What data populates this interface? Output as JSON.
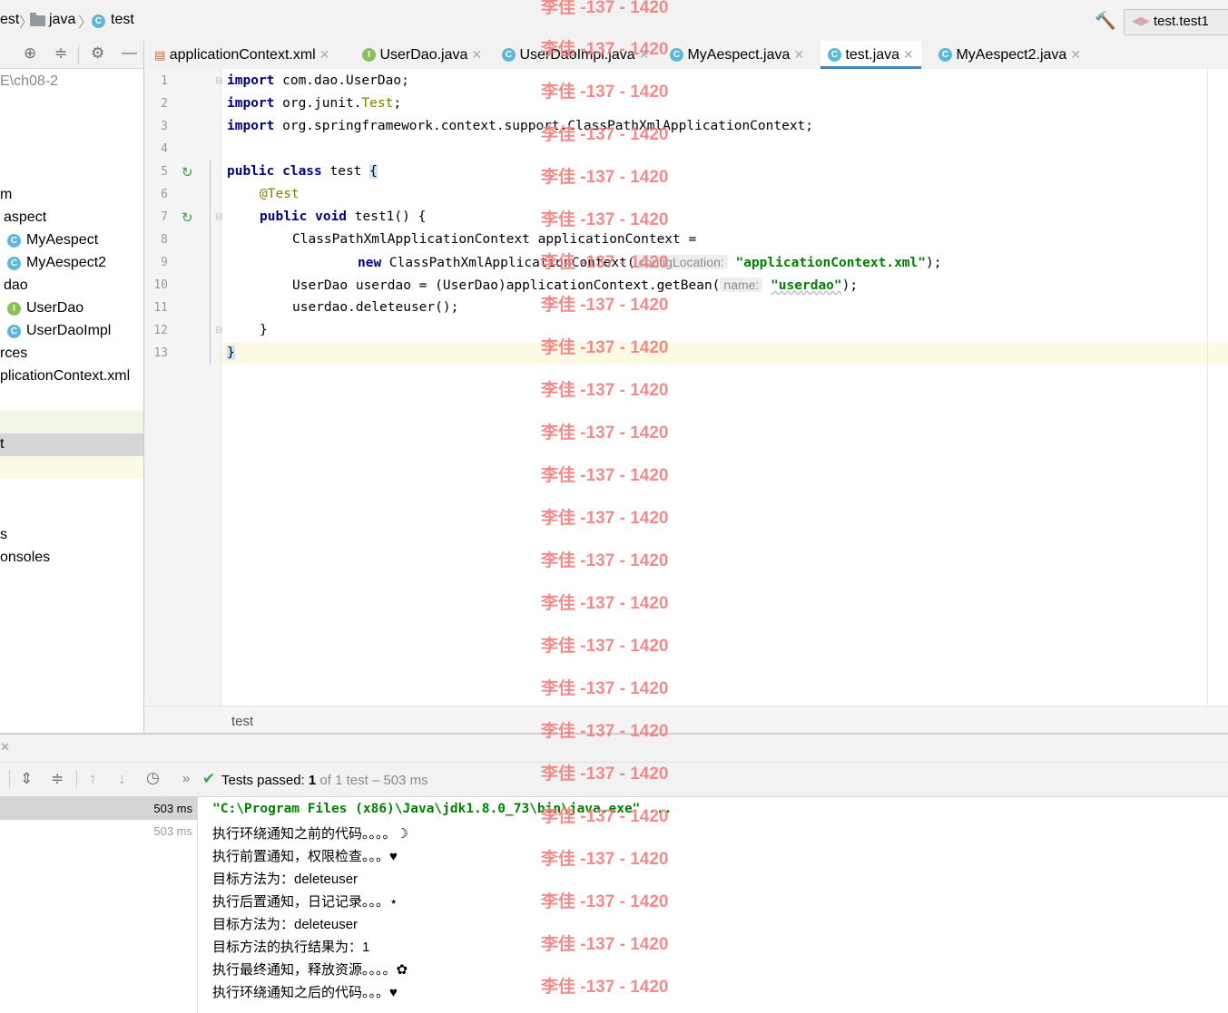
{
  "navbar": {
    "crumb_project": "est",
    "crumb_java": "java",
    "crumb_test": "test",
    "run_config": "test.test1"
  },
  "project": {
    "path": "E\\ch08-2",
    "items": [
      "m",
      "aspect",
      "MyAespect",
      "MyAespect2",
      "dao",
      "UserDao",
      "UserDaoImpl",
      "rces",
      "plicationContext.xml",
      "t",
      "s",
      "onsoles"
    ]
  },
  "tabs": [
    {
      "label": "applicationContext.xml"
    },
    {
      "label": "UserDao.java"
    },
    {
      "label": "UserDaoImpl.java"
    },
    {
      "label": "MyAespect.java"
    },
    {
      "label": "test.java"
    },
    {
      "label": "MyAespect2.java"
    }
  ],
  "editor": {
    "line_numbers": [
      "1",
      "2",
      "3",
      "4",
      "5",
      "6",
      "7",
      "8",
      "9",
      "10",
      "11",
      "12",
      "13"
    ],
    "code": {
      "l1_kw": "import",
      "l1_rest": " com.dao.UserDao;",
      "l2_kw": "import",
      "l2_a": " org.junit.",
      "l2_b": "Test",
      "l2_c": ";",
      "l3_kw": "import",
      "l3_rest": " org.springframework.context.support.ClassPathXmlApplicationContext;",
      "l5_kw": "public class",
      "l5_rest": " test ",
      "l5_brace": "{",
      "l6": "@Test",
      "l7_kw": "public void",
      "l7_rest": " test1() {",
      "l8": "ClassPathXmlApplicationContext applicationContext =",
      "l9_kw": "new",
      "l9_a": " ClassPathXmlApplicationContext(",
      "l9_hint": "configLocation:",
      "l9_str": "\"applicationContext.xml\"",
      "l9_end": ");",
      "l10_a": "UserDao userdao = (UserDao)applicationContext.getBean(",
      "l10_hint": "name:",
      "l10_str": "\"userdao\"",
      "l10_end": ");",
      "l11": "userdao.deleteuser();",
      "l12": "}",
      "l13": "}"
    },
    "breadcrumb": "test"
  },
  "run": {
    "status_label": "Tests passed:",
    "status_count": "1",
    "status_rest": "of 1 test – 503 ms",
    "tree_times": [
      "503 ms",
      "503 ms"
    ],
    "console": [
      "\"C:\\Program Files (x86)\\Java\\jdk1.8.0_73\\bin\\java.exe\" ...",
      "执行环绕通知之前的代码。。。。☽",
      "执行前置通知，权限检查。。。♥",
      "目标方法为：deleteuser",
      "执行后置通知，日记记录。。。⋆",
      "目标方法为：deleteuser",
      "目标方法的执行结果为：1",
      "执行最终通知，释放资源。。。。✿",
      "执行环绕通知之后的代码。。。♥"
    ]
  },
  "watermark": "李佳 -137 - 1420",
  "colors": {
    "accent": "#4083c9",
    "keyword": "#000080",
    "string": "#008000",
    "annotation": "#808000",
    "watermark": "#f08080",
    "pass": "#3aa34a"
  }
}
